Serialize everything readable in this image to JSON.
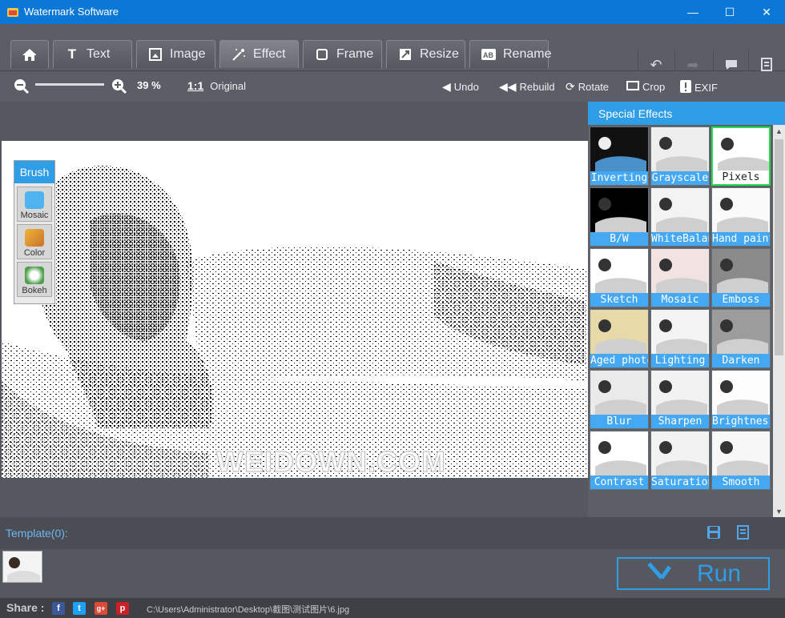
{
  "window": {
    "title": "Watermark Software",
    "controls": {
      "minimize": "—",
      "maximize": "☐",
      "close": "✕"
    }
  },
  "tabs": [
    {
      "name": "home",
      "label": "",
      "icon": "home-icon"
    },
    {
      "name": "text",
      "label": "Text",
      "icon": "text-icon"
    },
    {
      "name": "image",
      "label": "Image",
      "icon": "image-icon"
    },
    {
      "name": "effect",
      "label": "Effect",
      "icon": "magic-wand-icon",
      "active": true
    },
    {
      "name": "frame",
      "label": "Frame",
      "icon": "frame-icon"
    },
    {
      "name": "resize",
      "label": "Resize",
      "icon": "resize-icon"
    },
    {
      "name": "rename",
      "label": "Rename",
      "icon": "rename-icon"
    }
  ],
  "top_right_icons": [
    "undo-icon",
    "redo-icon",
    "chat-icon",
    "register-icon"
  ],
  "toolbar": {
    "zoom_percent": "39 %",
    "zoom_level": 0.39,
    "original_prefix": "1:1",
    "original_label": "Original",
    "undo_label": "Undo",
    "rebuild_label": "Rebuild",
    "rotate_label": "Rotate",
    "crop_label": "Crop",
    "exif_label": "EXIF"
  },
  "canvas": {
    "watermark": "WEIDOWN.COM"
  },
  "brush": {
    "title": "Brush",
    "items": [
      {
        "label": "Mosaic",
        "icon": "mosaic-icon"
      },
      {
        "label": "Color",
        "icon": "paintbrush-icon"
      },
      {
        "label": "Bokeh",
        "icon": "bokeh-icon"
      }
    ]
  },
  "effects": {
    "title": "Special Effects",
    "items": [
      {
        "label": "Inverting"
      },
      {
        "label": "Grayscale"
      },
      {
        "label": "Pixels",
        "selected": true
      },
      {
        "label": "B/W"
      },
      {
        "label": "WhiteBalance"
      },
      {
        "label": "Hand painted"
      },
      {
        "label": "Sketch"
      },
      {
        "label": "Mosaic"
      },
      {
        "label": "Emboss"
      },
      {
        "label": "Aged photo"
      },
      {
        "label": "Lighting"
      },
      {
        "label": "Darken"
      },
      {
        "label": "Blur"
      },
      {
        "label": "Sharpen"
      },
      {
        "label": "Brightness"
      },
      {
        "label": "Contrast"
      },
      {
        "label": "Saturation"
      },
      {
        "label": "Smooth"
      }
    ]
  },
  "template": {
    "label": "Template(0):"
  },
  "run": {
    "label": "Run"
  },
  "status": {
    "share_label": "Share :",
    "file_path": "C:\\Users\\Administrator\\Desktop\\截图\\测试图片\\6.jpg"
  },
  "colors": {
    "accent": "#2f9ee7",
    "titlebar": "#0b78d7",
    "selected_effect": "#23e04a"
  }
}
